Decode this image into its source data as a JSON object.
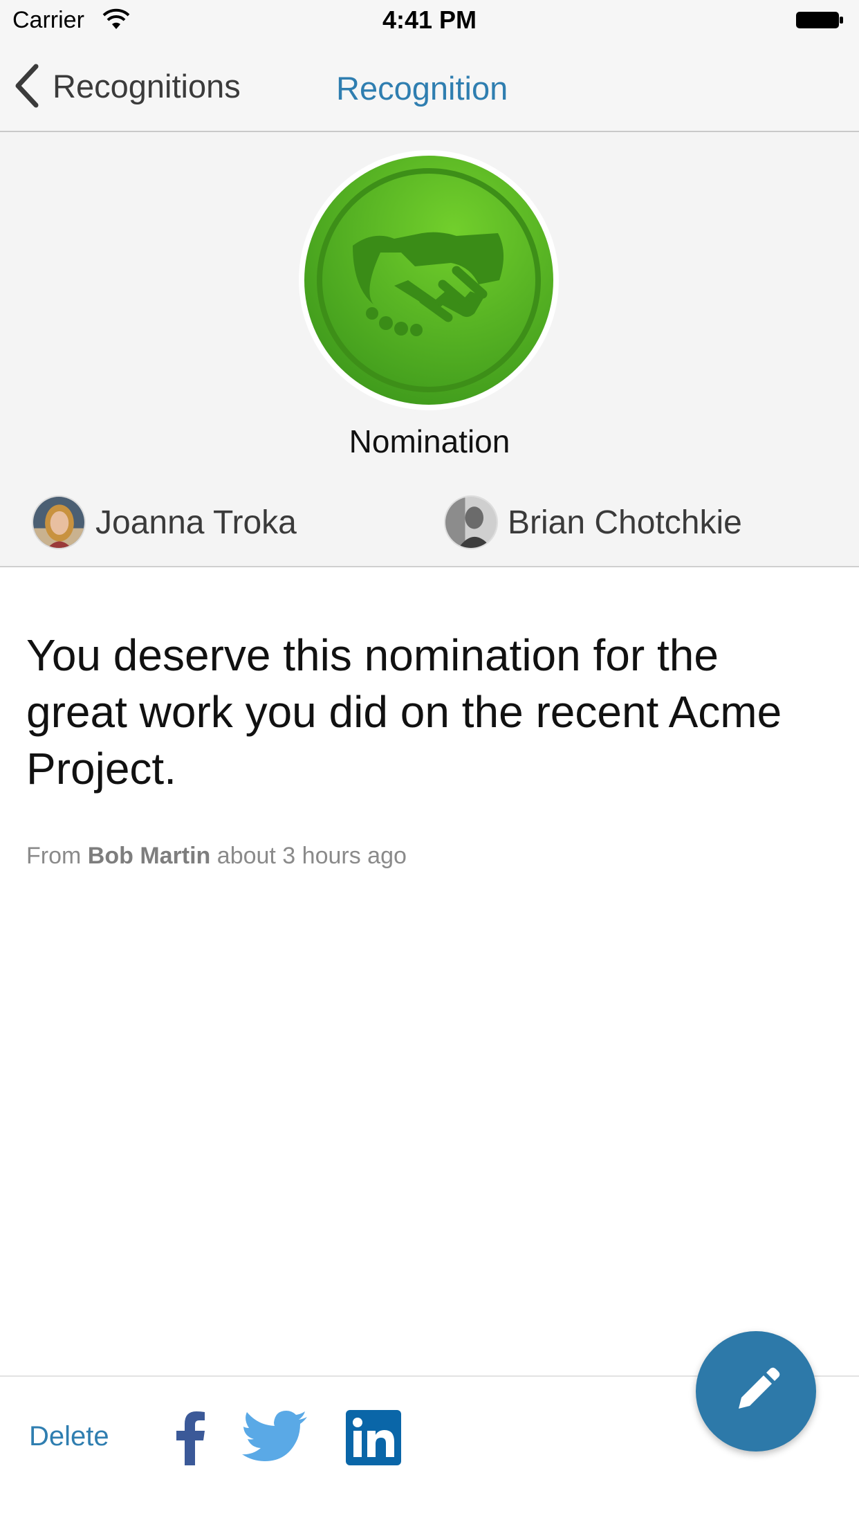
{
  "status_bar": {
    "carrier": "Carrier",
    "time": "4:41 PM"
  },
  "nav": {
    "back_label": "Recognitions",
    "title": "Recognition"
  },
  "award": {
    "name": "Nomination",
    "badge_icon": "handshake-icon",
    "badge_color": "#5cb82a"
  },
  "people": {
    "giver": "Joanna Troka",
    "receiver": "Brian Chotchkie"
  },
  "message": "You deserve this nomination for the great work you did on the recent Acme Project.",
  "meta": {
    "prefix": "From",
    "sender": "Bob Martin",
    "time": "about 3 hours ago"
  },
  "actions": {
    "delete_label": "Delete",
    "share_icons": [
      "facebook-icon",
      "twitter-icon",
      "linkedin-icon"
    ],
    "edit_icon": "pencil-icon"
  },
  "colors": {
    "accent": "#2f7eb0",
    "fab": "#2d79a9",
    "facebook": "#3b5998",
    "twitter": "#5aa9e6",
    "linkedin": "#0a66a8"
  }
}
